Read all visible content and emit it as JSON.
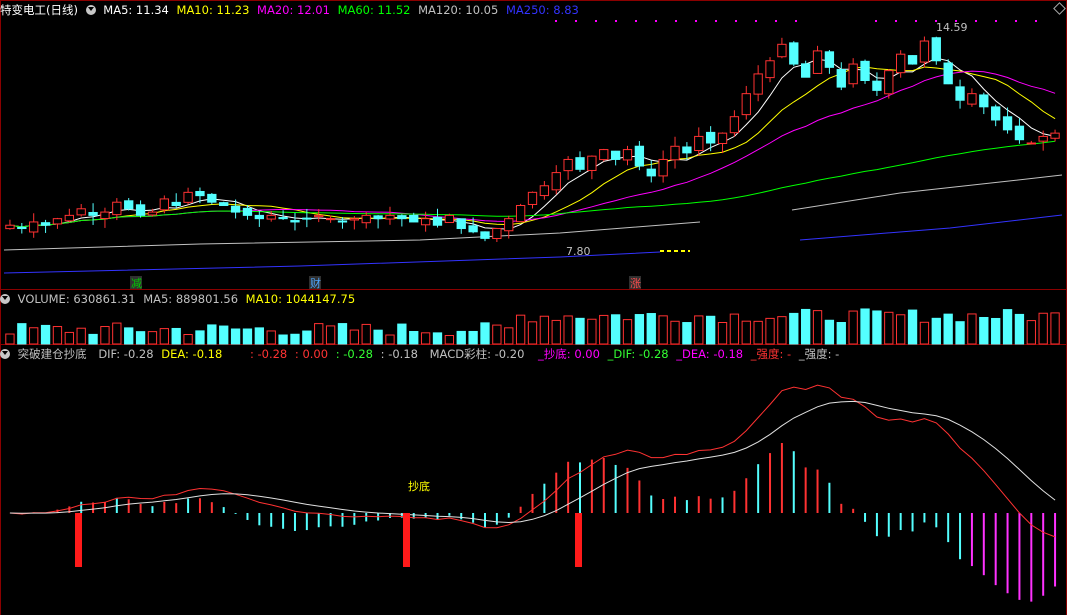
{
  "main_panel": {
    "title": "特变电工(日线)",
    "indicators": [
      {
        "label": "MA5: 11.34",
        "color": "#ffffff"
      },
      {
        "label": "MA10: 11.23",
        "color": "#ffff00"
      },
      {
        "label": "MA20: 12.01",
        "color": "#ff00ff"
      },
      {
        "label": "MA60: 11.52",
        "color": "#00ff00"
      },
      {
        "label": "MA120: 10.05",
        "color": "#c0c0c0"
      },
      {
        "label": "MA250: 8.83",
        "color": "#3333ff"
      }
    ],
    "high_label": "14.59",
    "low_label": "7.80",
    "event_marks": [
      {
        "text": "减",
        "color": "#00cc00"
      },
      {
        "text": "财",
        "color": "#4da6ff"
      },
      {
        "text": "涨",
        "color": "#ff4d4d"
      }
    ]
  },
  "volume_panel": {
    "indicators": [
      {
        "label": "VOLUME: 630861.31",
        "color": "#c0c0c0"
      },
      {
        "label": "MA5: 889801.56",
        "color": "#c0c0c0"
      },
      {
        "label": "MA10: 1044147.75",
        "color": "#ffff00"
      }
    ]
  },
  "macd_panel": {
    "title": "突破建仓抄底",
    "indicators": [
      {
        "label": "DIF: -0.28",
        "color": "#c0c0c0"
      },
      {
        "label": "DEA: -0.18",
        "color": "#ffff00"
      },
      {
        "label": ": -0.28",
        "color": "#ff3333"
      },
      {
        "label": ": 0.00",
        "color": "#ff3333"
      },
      {
        "label": ": -0.28",
        "color": "#33ff33"
      },
      {
        "label": ": -0.18",
        "color": "#c0c0c0"
      },
      {
        "label": "MACD彩柱: -0.20",
        "color": "#c0c0c0"
      },
      {
        "label": "_抄底: 0.00",
        "color": "#ff00ff"
      },
      {
        "label": "_DIF: -0.28",
        "color": "#33ff33"
      },
      {
        "label": "_DEA: -0.18",
        "color": "#ff00ff"
      },
      {
        "label": "_强度: -",
        "color": "#ff3333"
      },
      {
        "label": "_强度: -",
        "color": "#c0c0c0"
      }
    ],
    "signal_label": "抄底"
  },
  "chart_data": {
    "type": "candlestick",
    "title": "特变电工(日线)",
    "price_range": [
      7.8,
      14.59
    ],
    "price_extremes": {
      "high": 14.59,
      "low": 7.8
    },
    "moving_average_latest": {
      "MA5": 11.34,
      "MA10": 11.23,
      "MA20": 12.01,
      "MA60": 11.52,
      "MA120": 10.05,
      "MA250": 8.83
    },
    "close_estimates": [
      8.6,
      8.5,
      8.7,
      8.6,
      8.8,
      8.9,
      9.1,
      8.9,
      9.0,
      9.3,
      9.1,
      8.9,
      9.0,
      9.4,
      9.2,
      9.6,
      9.5,
      9.3,
      9.2,
      9.0,
      8.9,
      8.8,
      8.9,
      8.8,
      8.7,
      8.8,
      8.9,
      8.8,
      8.7,
      8.8,
      8.9,
      8.8,
      8.9,
      8.8,
      8.7,
      8.8,
      8.6,
      8.9,
      8.5,
      8.4,
      8.2,
      8.5,
      8.8,
      9.2,
      9.6,
      9.8,
      10.2,
      10.6,
      10.3,
      10.7,
      10.9,
      10.6,
      10.9,
      10.4,
      10.1,
      10.6,
      11.0,
      10.8,
      11.3,
      11.1,
      11.4,
      11.9,
      12.6,
      13.2,
      13.6,
      14.1,
      13.5,
      13.1,
      13.9,
      13.4,
      12.8,
      13.5,
      13.0,
      12.7,
      13.3,
      13.8,
      13.5,
      14.2,
      13.6,
      12.9,
      12.4,
      12.6,
      12.2,
      11.8,
      11.5,
      11.2,
      11.1,
      11.3,
      11.4
    ],
    "volume": {
      "latest": 630861.31,
      "MA5": 889801.56,
      "MA10": 1044147.75
    },
    "macd": {
      "DIF": -0.28,
      "DEA": -0.18,
      "MACD_bar": -0.2,
      "signals": [
        "抄底"
      ]
    }
  }
}
